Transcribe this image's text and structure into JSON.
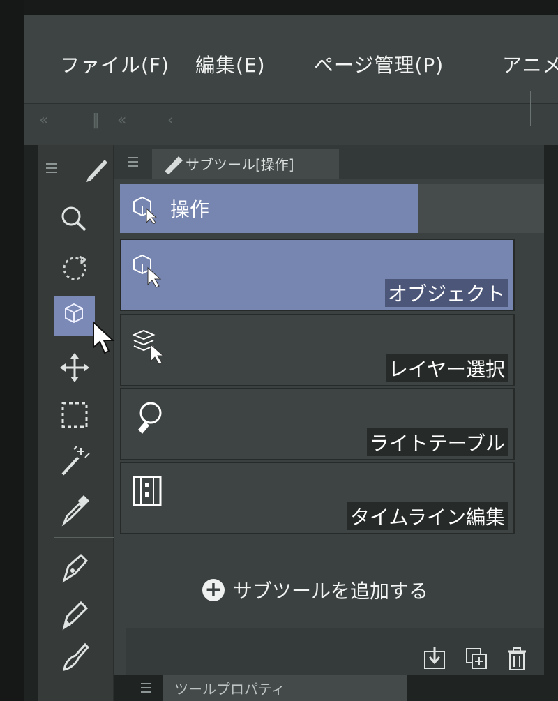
{
  "menu": {
    "file": "ファイル(F)",
    "edit": "編集(E)",
    "page": "ページ管理(P)",
    "anim": "アニメ"
  },
  "subtool_panel": {
    "tab_title": "サブツール[操作]",
    "group_label": "操作",
    "items": [
      {
        "label": "オブジェクト",
        "icon": "object-select-icon",
        "selected": true
      },
      {
        "label": "レイヤー選択",
        "icon": "layer-select-icon",
        "selected": false
      },
      {
        "label": "ライトテーブル",
        "icon": "light-table-icon",
        "selected": false
      },
      {
        "label": "タイムライン編集",
        "icon": "timeline-edit-icon",
        "selected": false
      }
    ],
    "add_label": "サブツールを追加する"
  },
  "toolbar": {
    "tools": [
      "zoom-icon",
      "rotate-icon",
      "operation-icon",
      "move-icon",
      "selection-rect-icon",
      "magic-wand-icon",
      "eyedropper-icon",
      "pen-icon",
      "pencil-icon",
      "brush-icon"
    ],
    "active": "operation-icon"
  },
  "bottom_tab": {
    "title": "ツールプロパティ"
  },
  "colors": {
    "accent": "#7785b1",
    "panel": "#3b4140",
    "bg": "#1f2322"
  }
}
